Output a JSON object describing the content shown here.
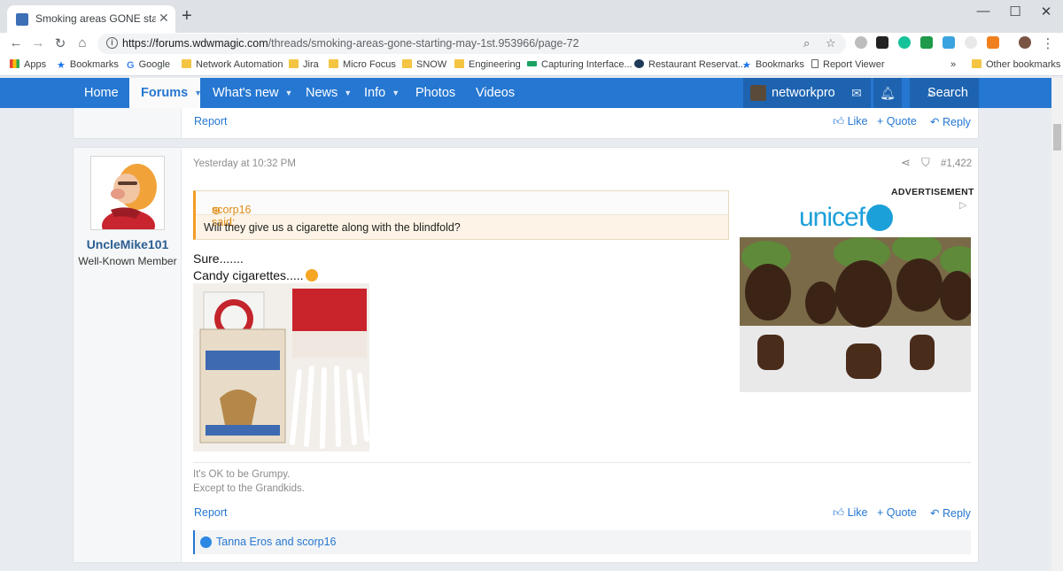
{
  "browser": {
    "tab_title": "Smoking areas GONE starting ma",
    "url_host": "https://forums.wdwmagic.com",
    "url_path": "/threads/smoking-areas-gone-starting-may-1st.953966/page-72",
    "bookmarks": [
      "Apps",
      "Bookmarks",
      "Google",
      "Network Automation",
      "Jira",
      "Micro Focus",
      "SNOW",
      "Engineering",
      "Capturing Interface...",
      "Restaurant Reservat...",
      "Bookmarks",
      "Report Viewer",
      "»",
      "Other bookmarks"
    ]
  },
  "nav": {
    "items": [
      "Home",
      "Forums",
      "What's new",
      "News",
      "Info",
      "Photos",
      "Videos"
    ],
    "username": "networkpro",
    "search_label": "Search"
  },
  "prev_post": {
    "report": "Report",
    "like": "Like",
    "quote": "Quote",
    "reply": "Reply"
  },
  "post": {
    "author": "UncleMike101",
    "user_title": "Well-Known Member",
    "date": "Yesterday at 10:32 PM",
    "number": "#1,422",
    "quote_author": "scorp16 said:",
    "quote_text": "Will they give us a cigarette along with the blindfold?",
    "line1": "Sure.......",
    "line2": "Candy cigarettes.....",
    "sig_line1": "It's OK to be Grumpy.",
    "sig_line2": "Except to the Grandkids.",
    "report": "Report",
    "like": "Like",
    "quote": "Quote",
    "reply": "Reply",
    "reactions": "Tanna Eros and scorp16"
  },
  "ad": {
    "label": "ADVERTISEMENT",
    "brand": "unicef"
  }
}
